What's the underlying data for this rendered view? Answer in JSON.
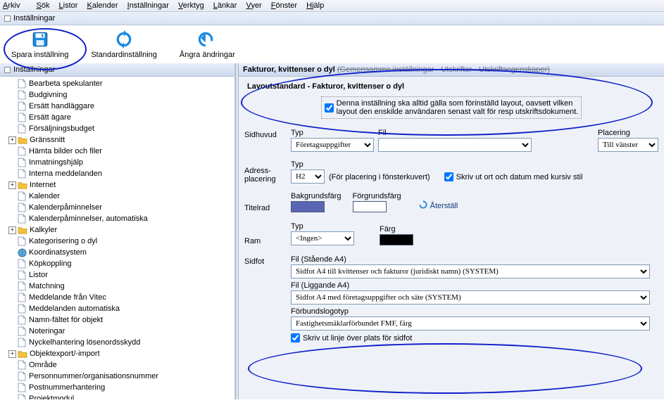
{
  "menu": {
    "arkiv": "Arkiv",
    "sok": "Sök",
    "listor": "Listor",
    "kalender": "Kalender",
    "installningar": "Inställningar",
    "verktyg": "Verktyg",
    "lankar": "Länkar",
    "vyer": "Vyer",
    "fonster": "Fönster",
    "hjalp": "Hjälp"
  },
  "window_title": "Inställningar",
  "toolbar": {
    "save": "Spara inställning",
    "standard": "Standardinställning",
    "undo": "Ångra ändringar"
  },
  "tree_header": "Inställningar",
  "tree": [
    {
      "label": "Bearbeta spekulanter",
      "icon": "page",
      "expander": null
    },
    {
      "label": "Budgivning",
      "icon": "page",
      "expander": null
    },
    {
      "label": "Ersätt handläggare",
      "icon": "page",
      "expander": null
    },
    {
      "label": "Ersätt ägare",
      "icon": "page",
      "expander": null
    },
    {
      "label": "Försäljningsbudget",
      "icon": "page",
      "expander": null
    },
    {
      "label": "Gränssnitt",
      "icon": "folder",
      "expander": "+"
    },
    {
      "label": "Hämta bilder och filer",
      "icon": "page",
      "expander": null
    },
    {
      "label": "Inmatningshjälp",
      "icon": "page",
      "expander": null
    },
    {
      "label": "Interna meddelanden",
      "icon": "page",
      "expander": null
    },
    {
      "label": "Internet",
      "icon": "folder",
      "expander": "+"
    },
    {
      "label": "Kalender",
      "icon": "page",
      "expander": null
    },
    {
      "label": "Kalenderpåminnelser",
      "icon": "page",
      "expander": null
    },
    {
      "label": "Kalenderpåminnelser, automatiska",
      "icon": "page",
      "expander": null
    },
    {
      "label": "Kalkyler",
      "icon": "folder",
      "expander": "+"
    },
    {
      "label": "Kategorisering o dyl",
      "icon": "page",
      "expander": null
    },
    {
      "label": "Koordinatsystem",
      "icon": "globe",
      "expander": null
    },
    {
      "label": "Köpkoppling",
      "icon": "page",
      "expander": null
    },
    {
      "label": "Listor",
      "icon": "page",
      "expander": null
    },
    {
      "label": "Matchning",
      "icon": "page",
      "expander": null
    },
    {
      "label": "Meddelande från Vitec",
      "icon": "page",
      "expander": null
    },
    {
      "label": "Meddelanden automatiska",
      "icon": "page",
      "expander": null
    },
    {
      "label": "Namn-fältet för objekt",
      "icon": "page",
      "expander": null
    },
    {
      "label": "Noteringar",
      "icon": "page",
      "expander": null
    },
    {
      "label": "Nyckelhantering lösenordsskydd",
      "icon": "page",
      "expander": null
    },
    {
      "label": "Objektexport/-import",
      "icon": "folder",
      "expander": "+"
    },
    {
      "label": "Område",
      "icon": "page",
      "expander": null
    },
    {
      "label": "Personnummer/organisationsnummer",
      "icon": "page",
      "expander": null
    },
    {
      "label": "Postnummerhantering",
      "icon": "page",
      "expander": null
    },
    {
      "label": "Projektmodul",
      "icon": "page",
      "expander": null
    }
  ],
  "crumb": {
    "main": "Fakturor, kvittenser o dyl",
    "rest": "(Gemensamma inställningar - Utskrifter - Utskriftsegenskaper)"
  },
  "group_title": "Layoutstandard - Fakturor, kvittenser o dyl",
  "force_layout": {
    "line1": "Denna inställning ska alltid gälla som förinställd layout, oavsett vilken",
    "line2": "layout den enskilde användaren senast valt för resp utskriftsdokument."
  },
  "labels": {
    "sidhuvud": "Sidhuvud",
    "typ": "Typ",
    "fil": "Fil",
    "placering": "Placering",
    "adress": "Adress-",
    "adress2": "placering",
    "adress_note": "(För placering i fönsterkuvert)",
    "cursive": "Skriv ut ort och datum med kursiv stil",
    "titelrad": "Titelrad",
    "bakgrund": "Bakgrundsfärg",
    "forgrund": "Förgrundsfärg",
    "aterstall": "Återställ",
    "ram": "Ram",
    "farg": "Färg",
    "sidfot": "Sidfot",
    "fil_staende": "Fil (Stående A4)",
    "fil_liggande": "Fil (Liggande A4)",
    "forbund": "Förbundslogotyp",
    "linje": "Skriv ut linje över plats för sidfot"
  },
  "values": {
    "sidhuvud_typ": "Företagsuppgifter",
    "sidhuvud_fil": "",
    "sidhuvud_plac": "Till vänster",
    "adress_typ": "H2",
    "ram_typ": "<Ingen>",
    "sidfot_staende": "Sidfot A4 till kvittenser och fakturor (juridiskt namn)  (SYSTEM)",
    "sidfot_liggande": "Sidfot A4 med företagsuppgifter och säte  (SYSTEM)",
    "forbund": "Fastighetsmäklarförbundet FMF, färg"
  },
  "colors": {
    "title_bg": "#5a65b4",
    "title_fg": "#ffffff",
    "ram": "#000000"
  }
}
